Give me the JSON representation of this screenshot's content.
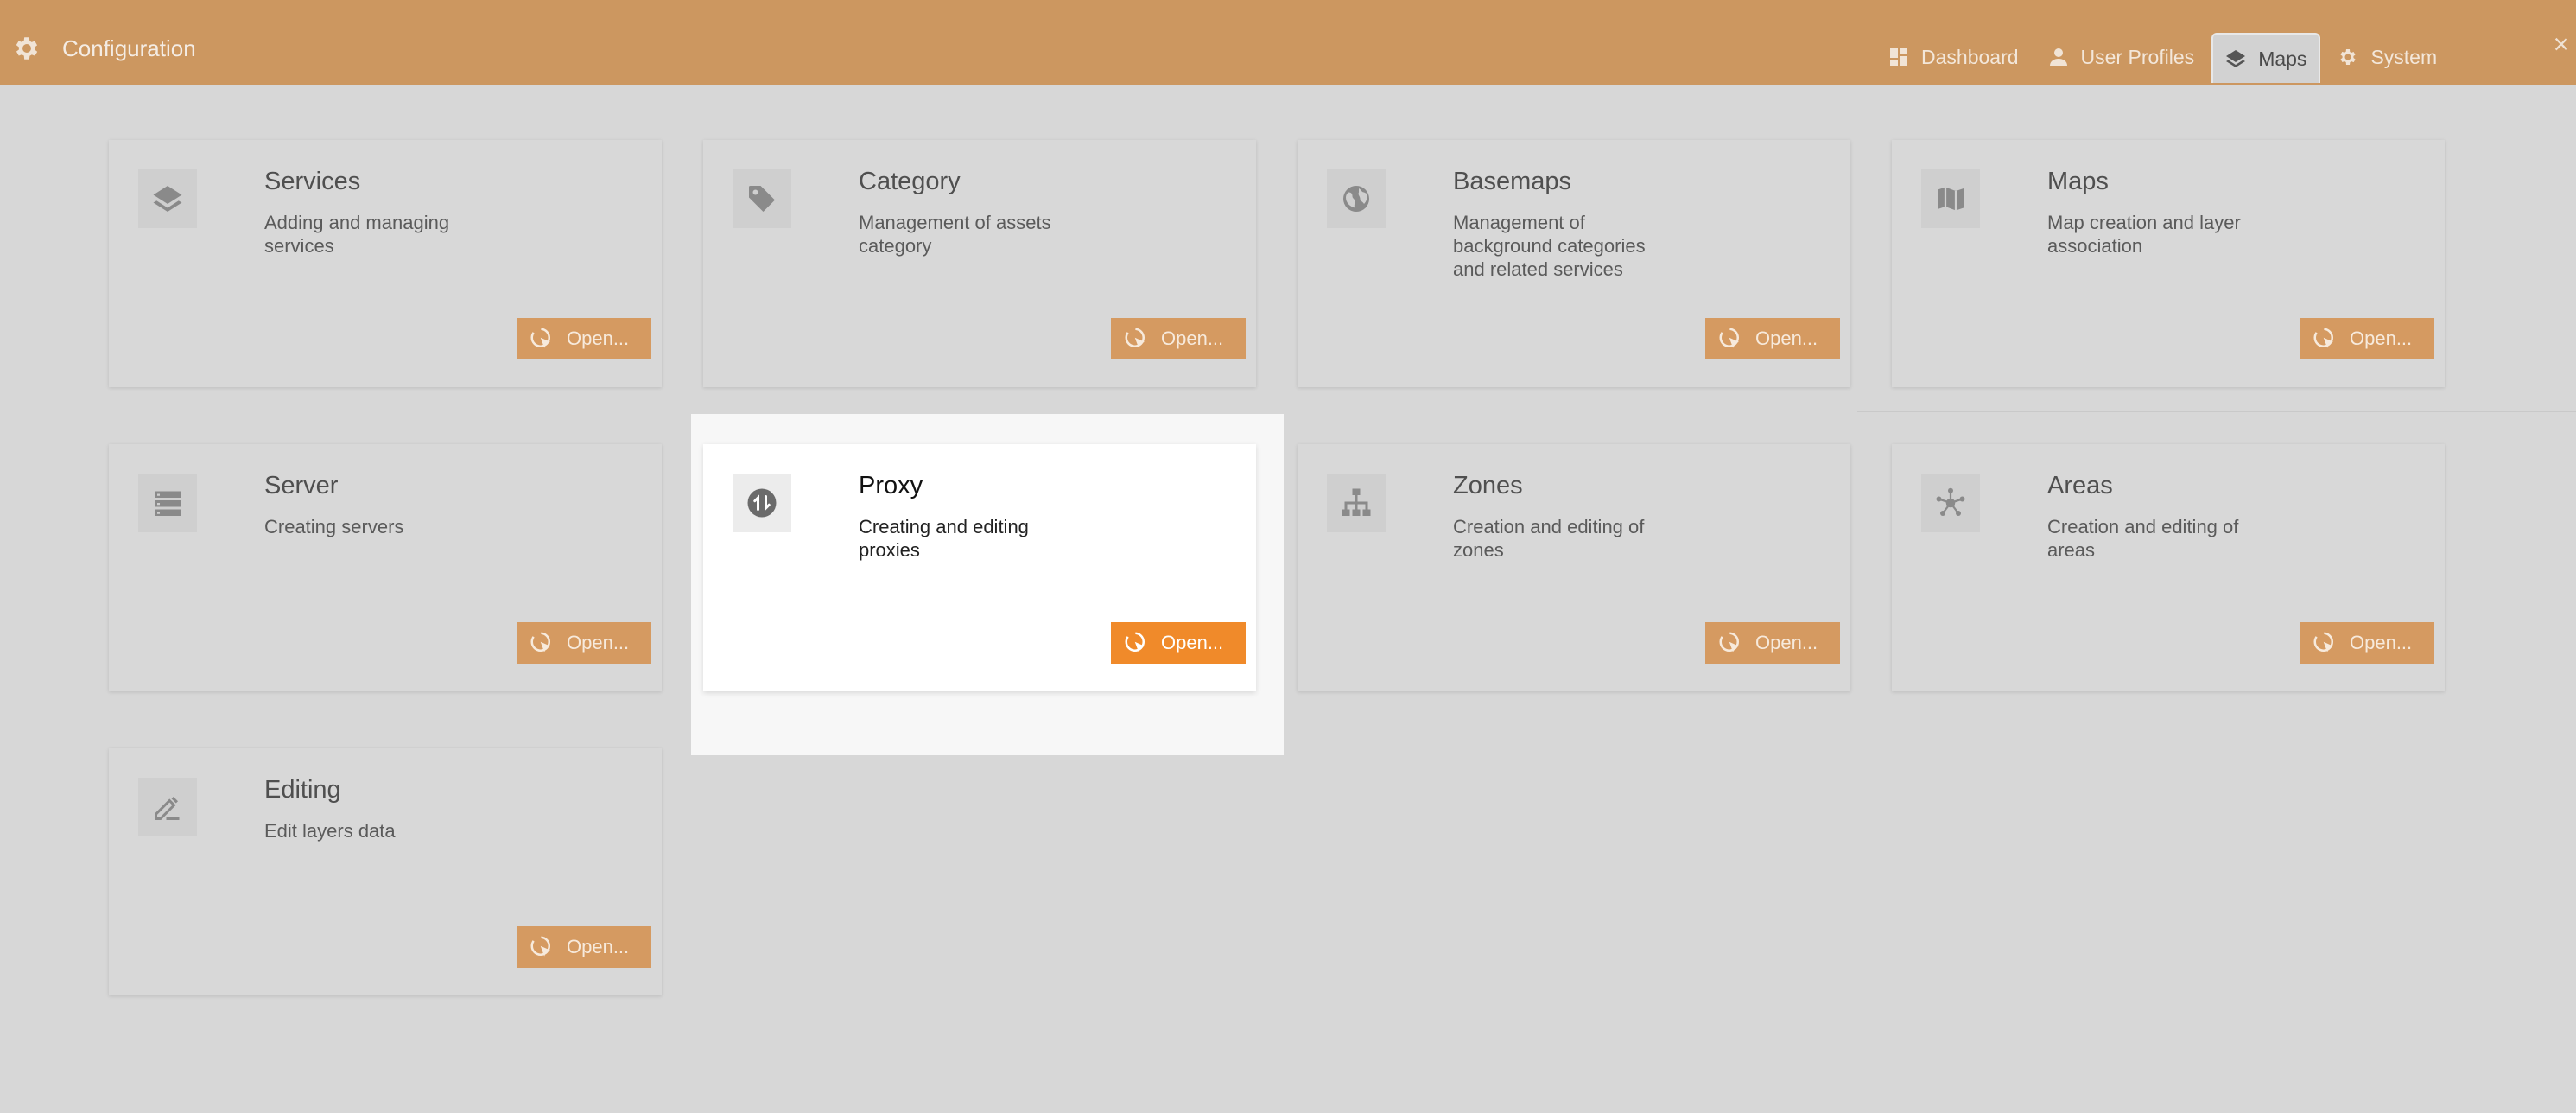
{
  "header": {
    "title": "Configuration",
    "icon": "gear-icon",
    "close_label": "×"
  },
  "nav": [
    {
      "label": "Dashboard",
      "icon": "dashboard-icon"
    },
    {
      "label": "User Profiles",
      "icon": "user-icon"
    },
    {
      "label": "Maps",
      "icon": "layers-icon",
      "active": true
    },
    {
      "label": "System",
      "icon": "gear-icon"
    }
  ],
  "cards": [
    {
      "name": "Services",
      "desc": "Adding and managing services",
      "icon": "layers-icon",
      "button": "Open..."
    },
    {
      "name": "Category",
      "desc": "Management of assets category",
      "icon": "tag-icon",
      "button": "Open..."
    },
    {
      "name": "Basemaps",
      "desc": "Management of background categories and related services",
      "icon": "globe-icon",
      "button": "Open..."
    },
    {
      "name": "Maps",
      "desc": "Map creation and layer association",
      "icon": "map-icon",
      "button": "Open..."
    },
    {
      "name": "Server",
      "desc": "Creating servers",
      "icon": "server-icon",
      "button": "Open..."
    },
    {
      "name": "Proxy",
      "desc": "Creating and editing proxies",
      "icon": "proxy-icon",
      "button": "Open...",
      "active": true
    },
    {
      "name": "Zones",
      "desc": "Creation and editing of zones",
      "icon": "hierarchy-icon",
      "button": "Open..."
    },
    {
      "name": "Areas",
      "desc": "Creation and editing of areas",
      "icon": "network-icon",
      "button": "Open..."
    },
    {
      "name": "Editing",
      "desc": "Edit layers data",
      "icon": "edit-icon",
      "button": "Open..."
    }
  ],
  "colors": {
    "header_bg": "#cc9760",
    "button_inactive": "#d59a61",
    "button_active": "#f08a2a",
    "page_bg": "#d7d7d7"
  }
}
